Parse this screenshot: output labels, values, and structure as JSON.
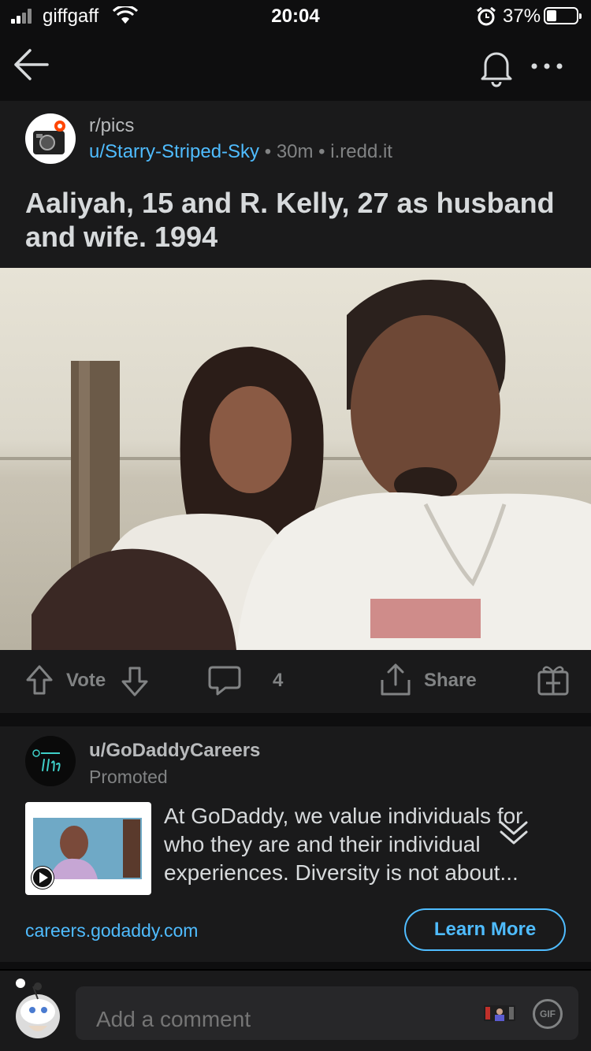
{
  "status_bar": {
    "carrier": "giffgaff",
    "time": "20:04",
    "battery": "37%",
    "battery_level": 0.37
  },
  "nav": {
    "icons": [
      "back-arrow-icon",
      "bell-icon",
      "more-options-icon"
    ]
  },
  "post": {
    "subreddit": "r/pics",
    "author": "u/Starry-Striped-Sky",
    "age": "30m",
    "domain": "i.redd.it",
    "title": "Aaliyah, 15 and R. Kelly, 27 as husband and wife. 1994",
    "actions": {
      "vote_label": "Vote",
      "comment_count": "4",
      "share_label": "Share"
    }
  },
  "promoted": {
    "author": "u/GoDaddyCareers",
    "tag": "Promoted",
    "logo_text": "GoDaddy life",
    "text": "At GoDaddy, we value individuals for who they are and their individual experiences. Diversity is not about...",
    "link": "careers.godaddy.com",
    "cta": "Learn More"
  },
  "comment_bar": {
    "placeholder": "Add a comment",
    "gif_label": "GIF"
  },
  "colors": {
    "background": "#0e0e0f",
    "card": "#1a1a1b",
    "accent_blue": "#4fbcff",
    "muted_text": "#818384",
    "primary_text": "#d7dadc"
  }
}
